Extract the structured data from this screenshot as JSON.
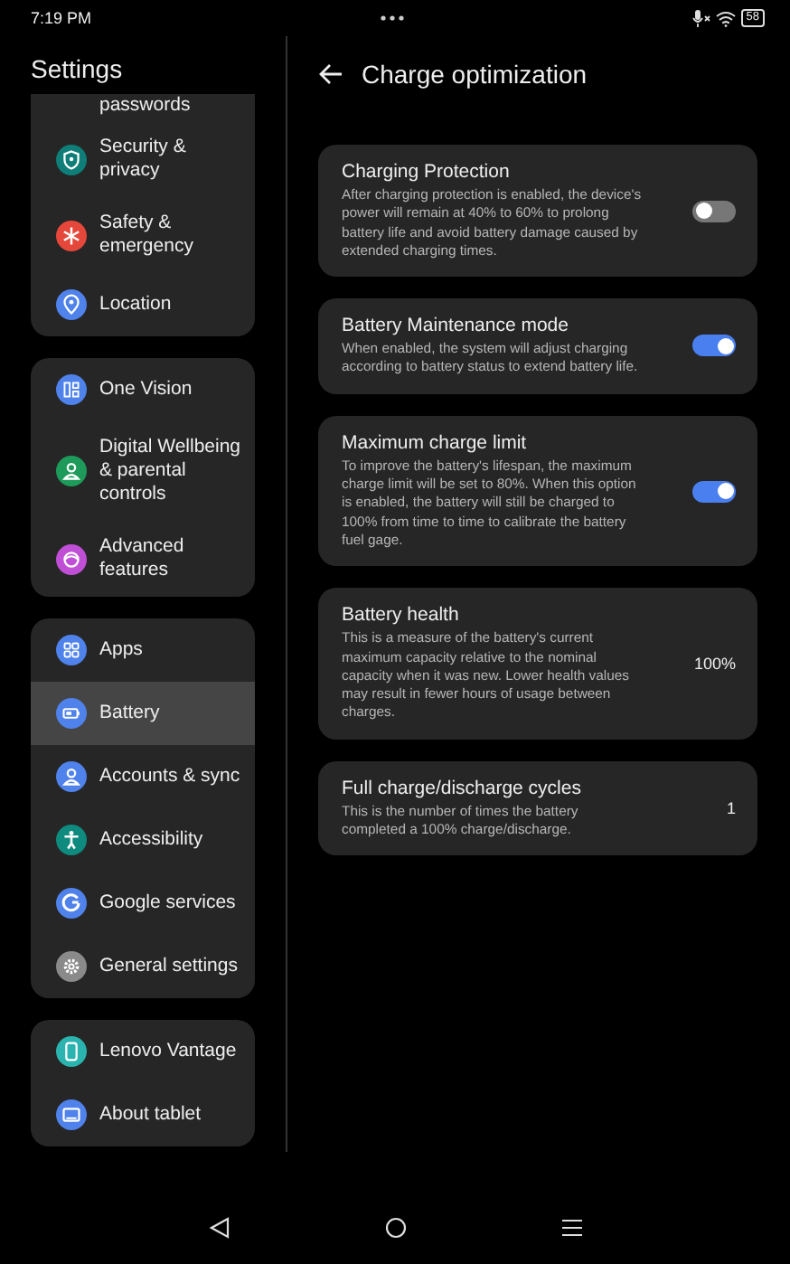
{
  "status_bar": {
    "time": "7:19 PM",
    "battery": "58"
  },
  "sidebar": {
    "title": "Settings",
    "groups": [
      {
        "items": [
          {
            "label": "passwords",
            "selected": false
          },
          {
            "label": "Security & privacy",
            "color": "#0f7d78",
            "selected": false
          },
          {
            "label": "Safety & emergency",
            "color": "#e5483b",
            "selected": false
          },
          {
            "label": "Location",
            "color": "#4f82ea",
            "selected": false
          }
        ]
      },
      {
        "items": [
          {
            "label": "One Vision",
            "color": "#4f82ea",
            "selected": false
          },
          {
            "label": "Digital Wellbeing & parental controls",
            "color": "#1e9a5a",
            "selected": false
          },
          {
            "label": "Advanced features",
            "color": "#c04fd6",
            "selected": false
          }
        ]
      },
      {
        "items": [
          {
            "label": "Apps",
            "color": "#4f82ea",
            "selected": false
          },
          {
            "label": "Battery",
            "color": "#4f82ea",
            "selected": true
          },
          {
            "label": "Accounts & sync",
            "color": "#4f82ea",
            "selected": false
          },
          {
            "label": "Accessibility",
            "color": "#0f8a7e",
            "selected": false
          },
          {
            "label": "Google services",
            "color": "#4f82ea",
            "selected": false
          },
          {
            "label": "General settings",
            "color": "#8a8a8a",
            "selected": false
          }
        ]
      },
      {
        "items": [
          {
            "label": "Lenovo Vantage",
            "color": "#2bb3b0",
            "selected": false
          },
          {
            "label": "About tablet",
            "color": "#4f82ea",
            "selected": false
          }
        ]
      }
    ]
  },
  "page": {
    "title": "Charge optimization",
    "settings": [
      {
        "kind": "toggle",
        "title": "Charging Protection",
        "description": "After charging protection is enabled, the device's power will remain at 40% to 60% to prolong battery life and avoid battery damage caused by extended charging times.",
        "on": false
      },
      {
        "kind": "toggle",
        "title": "Battery Maintenance mode",
        "description": "When enabled, the system will adjust charging according to battery status to extend battery life.",
        "on": true
      },
      {
        "kind": "toggle",
        "title": "Maximum charge limit",
        "description": "To improve the battery's lifespan, the maximum charge limit will be set to 80%. When this option is enabled, the battery will still be charged to 100% from time to time to calibrate the battery fuel gage.",
        "on": true
      },
      {
        "kind": "value",
        "title": "Battery health",
        "description": "This is a measure of the battery's current maximum capacity relative to the nominal capacity when it was new. Lower health values may result in fewer hours of usage between charges.",
        "value": "100%"
      },
      {
        "kind": "value",
        "title": "Full charge/discharge cycles",
        "description": "This is the number of times the battery completed a 100% charge/discharge.",
        "value": "1"
      }
    ]
  }
}
